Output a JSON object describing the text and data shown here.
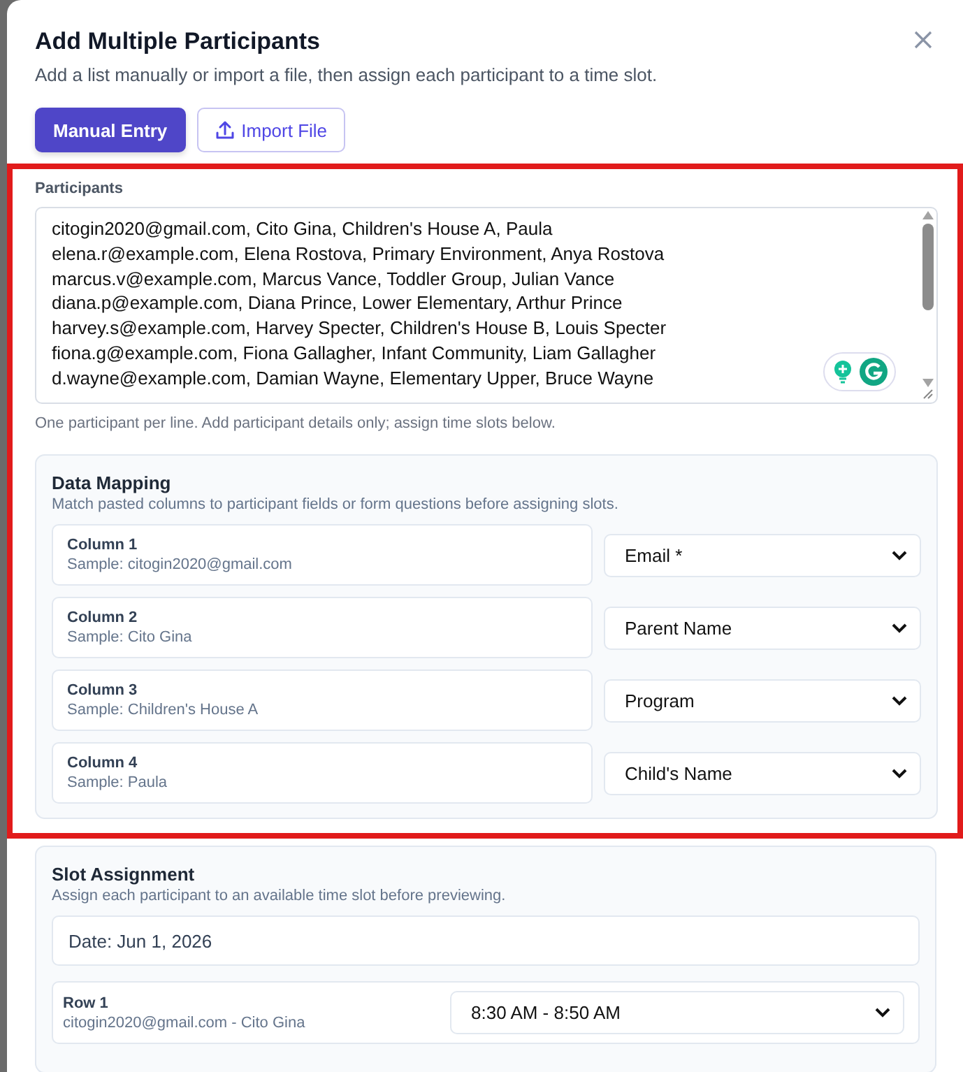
{
  "dialog": {
    "title": "Add Multiple Participants",
    "subtitle": "Add a list manually or import a file, then assign each participant to a time slot."
  },
  "modes": [
    {
      "label": "Manual Entry",
      "selected": true,
      "kind": "text"
    },
    {
      "label": "Import File",
      "selected": false,
      "kind": "upload"
    }
  ],
  "participants": {
    "label": "Participants",
    "lines": [
      "citogin2020@gmail.com, Cito Gina, Children's House A, Paula",
      "elena.r@example.com, Elena Rostova, Primary Environment, Anya Rostova",
      "marcus.v@example.com, Marcus Vance, Toddler Group, Julian Vance",
      "diana.p@example.com, Diana Prince, Lower Elementary, Arthur Prince",
      "harvey.s@example.com, Harvey Specter, Children's House B, Louis Specter",
      "fiona.g@example.com, Fiona Gallagher, Infant Community, Liam Gallagher",
      "d.wayne@example.com, Damian Wayne, Elementary Upper, Bruce Wayne"
    ],
    "hint": "One participant per line. Add participant details only; assign time slots below."
  },
  "data_mapping": {
    "title": "Data Mapping",
    "subtitle": "Match pasted columns to participant fields or form questions before assigning slots.",
    "columns": [
      {
        "name": "Column 1",
        "sample": "Sample: citogin2020@gmail.com",
        "field": "Email *"
      },
      {
        "name": "Column 2",
        "sample": "Sample: Cito Gina",
        "field": "Parent Name"
      },
      {
        "name": "Column 3",
        "sample": "Sample: Children's House A",
        "field": "Program"
      },
      {
        "name": "Column 4",
        "sample": "Sample: Paula",
        "field": "Child's Name"
      }
    ]
  },
  "slot_assignment": {
    "title": "Slot Assignment",
    "subtitle": "Assign each participant to an available time slot before previewing.",
    "date": "Date: Jun 1, 2026",
    "rows": [
      {
        "name": "Row 1",
        "detail": "citogin2020@gmail.com - Cito Gina",
        "slot": "8:30 AM - 8:50 AM"
      }
    ]
  }
}
